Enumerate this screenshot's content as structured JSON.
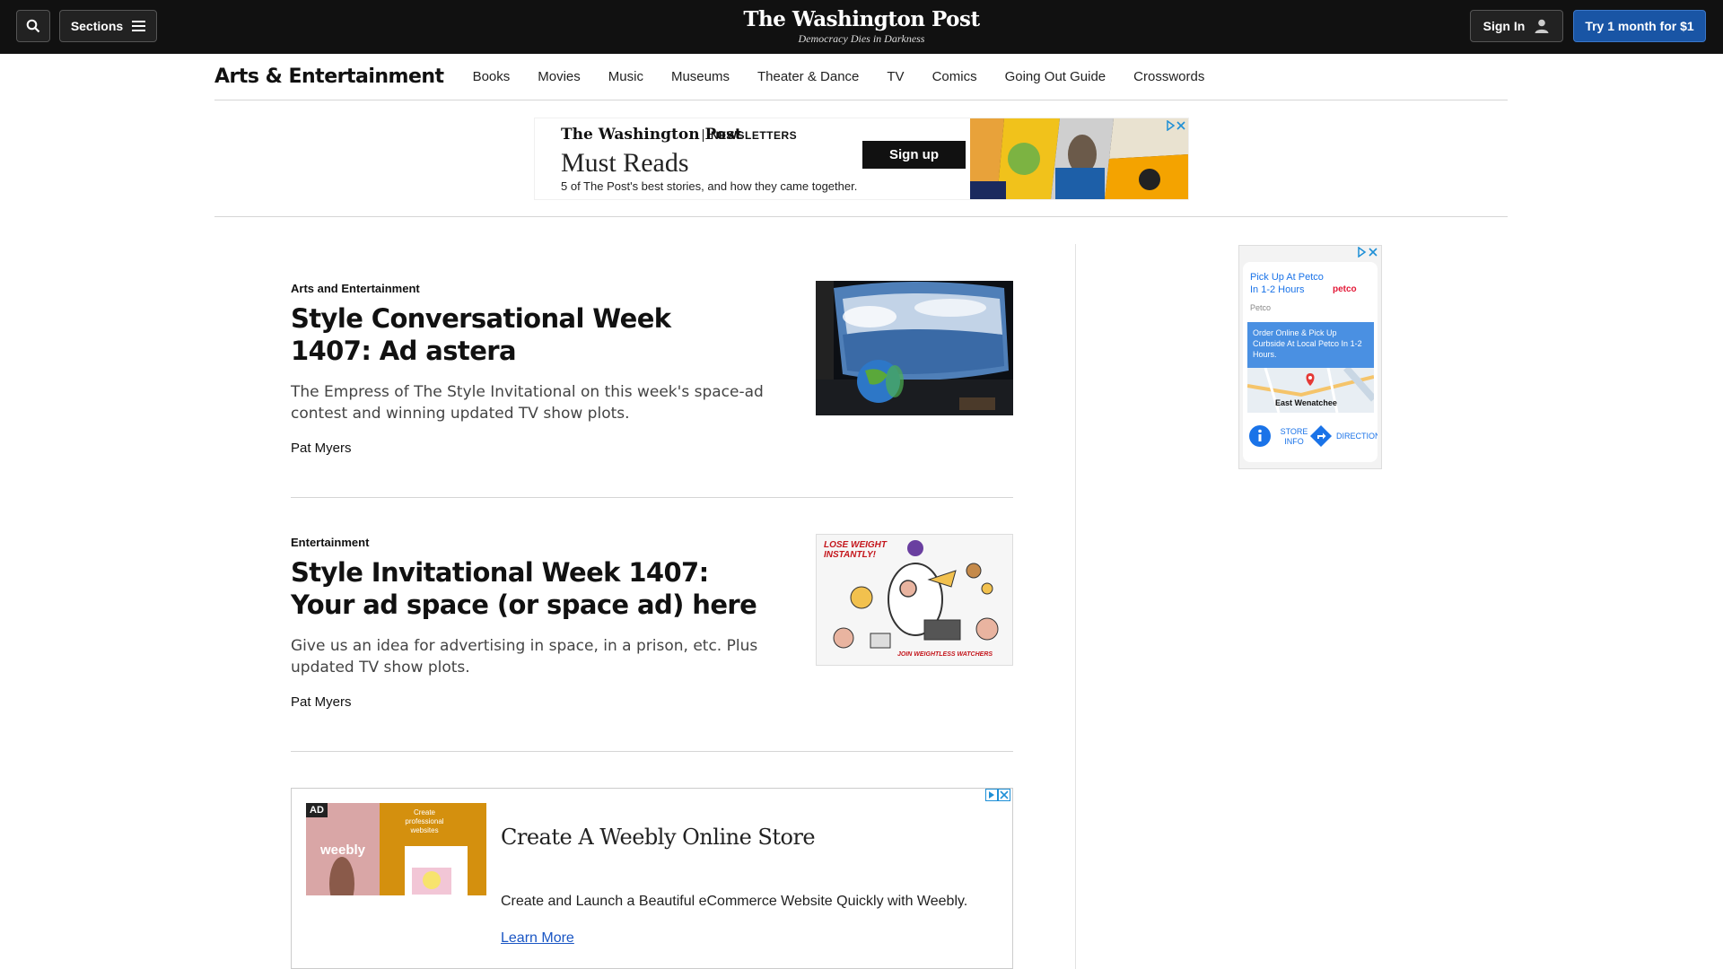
{
  "header": {
    "sections_label": "Sections",
    "logo": "The Washington Post",
    "tagline": "Democracy Dies in Darkness",
    "signin_label": "Sign In",
    "try_label": "Try 1 month for $1"
  },
  "section_nav": {
    "title": "Arts & Entertainment",
    "items": [
      "Books",
      "Movies",
      "Music",
      "Museums",
      "Theater & Dance",
      "TV",
      "Comics",
      "Going Out Guide",
      "Crosswords"
    ]
  },
  "banner_ad": {
    "logo": "The Washington Post",
    "label": "NEWSLETTERS",
    "headline": "Must Reads",
    "sub": "5 of The Post's best stories, and how they came together.",
    "button": "Sign up"
  },
  "articles": [
    {
      "kicker": "Arts and Entertainment",
      "headline": "Style Conversational Week 1407: Ad astera",
      "blurb": "The Empress of The Style Invitational on this week's space-ad contest and winning updated TV show plots.",
      "byline": "Pat Myers"
    },
    {
      "kicker": "Entertainment",
      "headline": "Style Invitational Week 1407: Your ad space (or space ad) here",
      "blurb": "Give us an idea for advertising in space, in a prison, etc. Plus updated TV show plots.",
      "byline": "Pat Myers",
      "thumb_caption_top": "LOSE WEIGHT INSTANTLY!",
      "thumb_caption_bottom": "JOIN WEIGHTLESS WATCHERS"
    }
  ],
  "native_ad": {
    "label": "AD",
    "image_text": "Create professional websites",
    "image_brand": "weebly",
    "title": "Create A Weebly Online Store",
    "description": "Create and Launch a Beautiful eCommerce Website Quickly with Weebly.",
    "link": "Learn More"
  },
  "side_ad": {
    "title": "Pick Up At Petco In 1-2 Hours",
    "brand": "petco",
    "source": "Petco",
    "box_text": "Order Online & Pick Up Curbside At Local Petco In 1-2 Hours.",
    "location": "East Wenatchee",
    "store_info": "STORE INFO",
    "directions": "DIRECTION"
  },
  "colors": {
    "topbar": "#111111",
    "try_button": "#1955a5",
    "link": "#1a56c4"
  }
}
